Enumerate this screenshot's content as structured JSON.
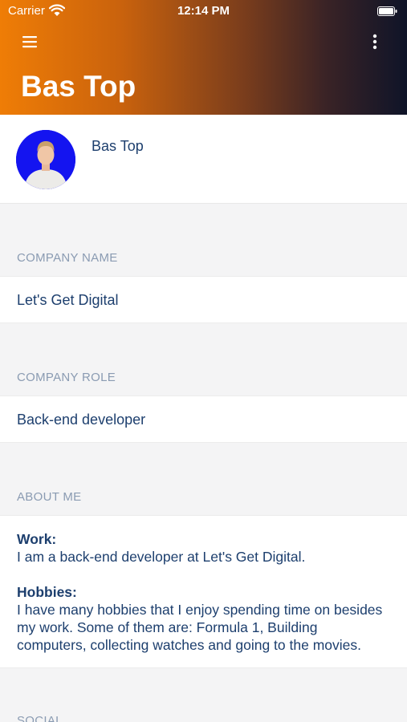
{
  "status_bar": {
    "carrier": "Carrier",
    "time": "12:14 PM"
  },
  "header": {
    "title": "Bas Top",
    "gradient_colors": [
      "#ef7d06",
      "#0f1428"
    ],
    "menu_icon": "hamburger-menu-icon",
    "more_icon": "vertical-ellipsis-icon"
  },
  "profile": {
    "name": "Bas Top",
    "avatar_background": "#1414f0"
  },
  "sections": {
    "company_name": {
      "label": "COMPANY NAME",
      "value": "Let's Get Digital"
    },
    "company_role": {
      "label": "COMPANY ROLE",
      "value": "Back-end developer"
    },
    "about_me": {
      "label": "ABOUT ME",
      "work_heading": "Work:",
      "work_text": "I am a back-end developer at Let's Get Digital.",
      "hobbies_heading": "Hobbies:",
      "hobbies_text": "I have many hobbies that I enjoy spending time on besides my work. Some of them are: Formula 1, Building computers, collecting watches and going to the movies."
    },
    "social": {
      "label": "SOCIAL"
    }
  },
  "colors": {
    "text_primary": "#1d3f6e",
    "section_label": "#8a9bb2",
    "background": "#f4f4f5"
  }
}
